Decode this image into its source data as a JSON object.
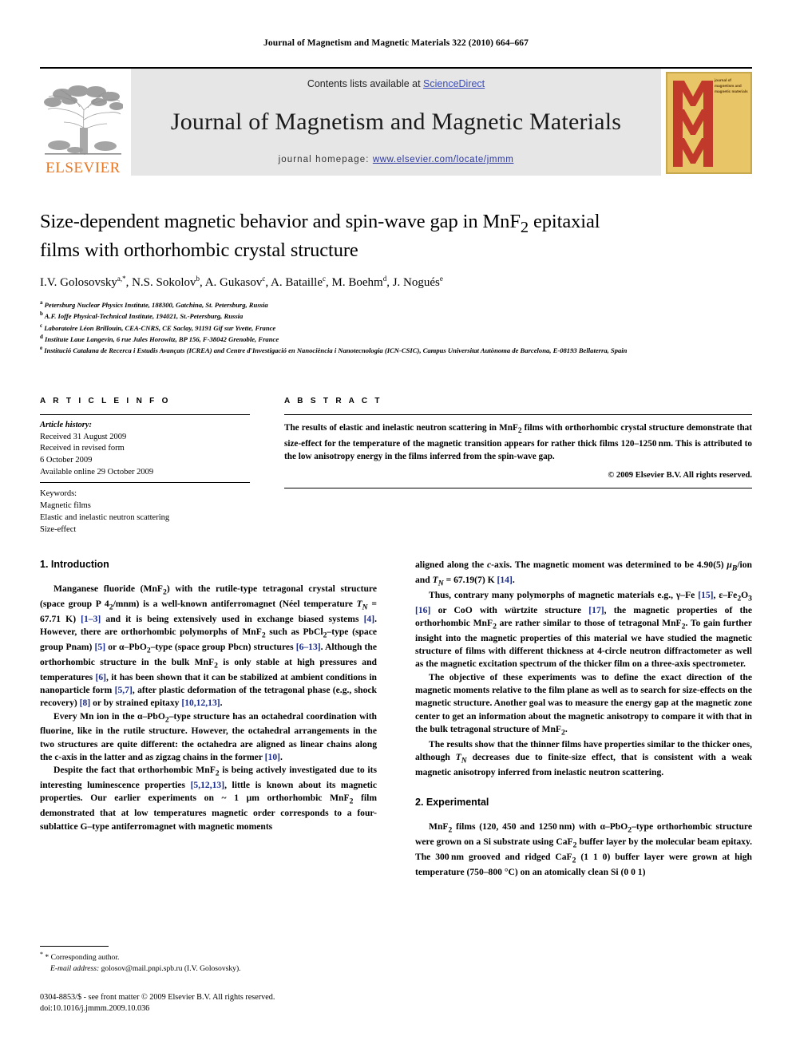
{
  "running_head": "Journal of Magnetism and Magnetic Materials 322 (2010) 664–667",
  "masthead": {
    "contents_prefix": "Contents lists available at ",
    "sciencedirect": "ScienceDirect",
    "journal_title": "Journal of Magnetism and Magnetic Materials",
    "homepage_prefix": "journal homepage: ",
    "homepage_url": "www.elsevier.com/locate/jmmm",
    "elsevier_wordmark": "ELSEVIER",
    "cover_caption": "journal of magnetism and magnetic materials",
    "accent_link_color": "#2b37a0",
    "elsevier_orange": "#e87722",
    "cover_bg": "#e8c567",
    "cover_red": "#c0392b"
  },
  "article": {
    "title": "Size-dependent magnetic behavior and spin-wave gap in MnF₂ epitaxial films with orthorhombic crystal structure",
    "authors": "I.V. Golosovsky a,*, N.S. Sokolov b, A. Gukasov c, A. Bataille c, M. Boehm d, J. Nogués e",
    "affiliations": [
      "a Petersburg Nuclear Physics Institute, 188300, Gatchina, St. Petersburg, Russia",
      "b A.F. Ioffe Physical-Technical Institute, 194021, St.-Petersburg, Russia",
      "c Laboratoire Léon Brillouin, CEA-CNRS, CE Saclay, 91191 Gif sur Yvette, France",
      "d Institute Laue Langevin, 6 rue Jules Horowitz, BP 156, F-38042 Grenoble, France",
      "e Institució Catalana de Recerca i Estudis Avançats (ICREA) and Centre d'Investigació en Nanociència i Nanotecnologia (ICN-CSIC), Campus Universitat Autònoma de Barcelona, E-08193 Bellaterra, Spain"
    ]
  },
  "article_info": {
    "heading": "A R T I C L E   I N F O",
    "history_label": "Article history:",
    "history": [
      "Received 31 August 2009",
      "Received in revised form",
      "6 October 2009",
      "Available online 29 October 2009"
    ],
    "keywords_label": "Keywords:",
    "keywords": [
      "Magnetic films",
      "Elastic and inelastic neutron scattering",
      "Size-effect"
    ]
  },
  "abstract": {
    "heading": "A B S T R A C T",
    "text": "The results of elastic and inelastic neutron scattering in MnF₂ films with orthorhombic crystal structure demonstrate that size-effect for the temperature of the magnetic transition appears for rather thick films 120–1250 nm. This is attributed to the low anisotropy energy in the films inferred from the spin-wave gap.",
    "copyright": "© 2009 Elsevier B.V. All rights reserved."
  },
  "sections": {
    "introduction_heading": "1.  Introduction",
    "experimental_heading": "2.  Experimental",
    "intro_p1": "Manganese fluoride (MnF₂) with the rutile-type tetragonal crystal structure (space group P 4₂/mnm) is a well-known antiferromagnet (Néel temperature T_N = 67.71 K) [1–3] and it is being extensively used in exchange biased systems [4]. However, there are orthorhombic polymorphs of MnF₂ such as PbCl₂–type (space group Pnam) [5] or α–PbO₂–type (space group Pbcn) structures [6–13]. Although the orthorhombic structure in the bulk MnF₂ is only stable at high pressures and temperatures [6], it has been shown that it can be stabilized at ambient conditions in nanoparticle form [5,7], after plastic deformation of the tetragonal phase (e.g., shock recovery) [8] or by strained epitaxy [10,12,13].",
    "intro_p2": "Every Mn ion in the α–PbO₂–type structure has an octahedral coordination with fluorine, like in the rutile structure. However, the octahedral arrangements in the two structures are quite different: the octahedra are aligned as linear chains along the c-axis in the latter and as zigzag chains in the former [10].",
    "intro_p3": "Despite the fact that orthorhombic MnF₂ is being actively investigated due to its interesting luminescence properties [5,12,13], little is known about its magnetic properties. Our earlier experiments on ~ 1 μm orthorhombic MnF₂ film demonstrated that at low temperatures magnetic order corresponds to a four-sublattice G–type antiferromagnet with magnetic moments",
    "right_p1": "aligned along the c-axis. The magnetic moment was determined to be 4.90(5) μ_B/ion and T_N = 67.19(7) K [14].",
    "right_p2": "Thus, contrary many polymorphs of magnetic materials e.g., γ–Fe [15], ε–Fe₂O₃ [16] or CoO with würtzite structure [17], the magnetic properties of the orthorhombic MnF₂ are rather similar to those of tetragonal MnF₂. To gain further insight into the magnetic properties of this material we have studied the magnetic structure of films with different thickness at 4-circle neutron diffractometer as well as the magnetic excitation spectrum of the thicker film on a three-axis spectrometer.",
    "right_p3": "The objective of these experiments was to define the exact direction of the magnetic moments relative to the film plane as well as to search for size-effects on the magnetic structure. Another goal was to measure the energy gap at the magnetic zone center to get an information about the magnetic anisotropy to compare it with that in the bulk tetragonal structure of MnF₂.",
    "right_p4": "The results show that the thinner films have properties similar to the thicker ones, although T_N decreases due to finite-size effect, that is consistent with a weak magnetic anisotropy inferred from inelastic neutron scattering.",
    "exp_p1": "MnF₂ films (120, 450 and 1250 nm) with α–PbO₂–type orthorhombic structure were grown on a Si substrate using CaF₂ buffer layer by the molecular beam epitaxy. The 300 nm grooved and ridged CaF₂ (1 1 0) buffer layer were grown at high temperature (750–800 °C) on an atomically clean Si (0 0 1)"
  },
  "footnotes": {
    "corresponding": "* Corresponding author.",
    "email_label": "E-mail address:",
    "email": "golosov@mail.pnpi.spb.ru (I.V. Golosovsky)."
  },
  "imprint": {
    "line1": "0304-8853/$ - see front matter © 2009 Elsevier B.V. All rights reserved.",
    "line2": "doi:10.1016/j.jmmm.2009.10.036"
  }
}
